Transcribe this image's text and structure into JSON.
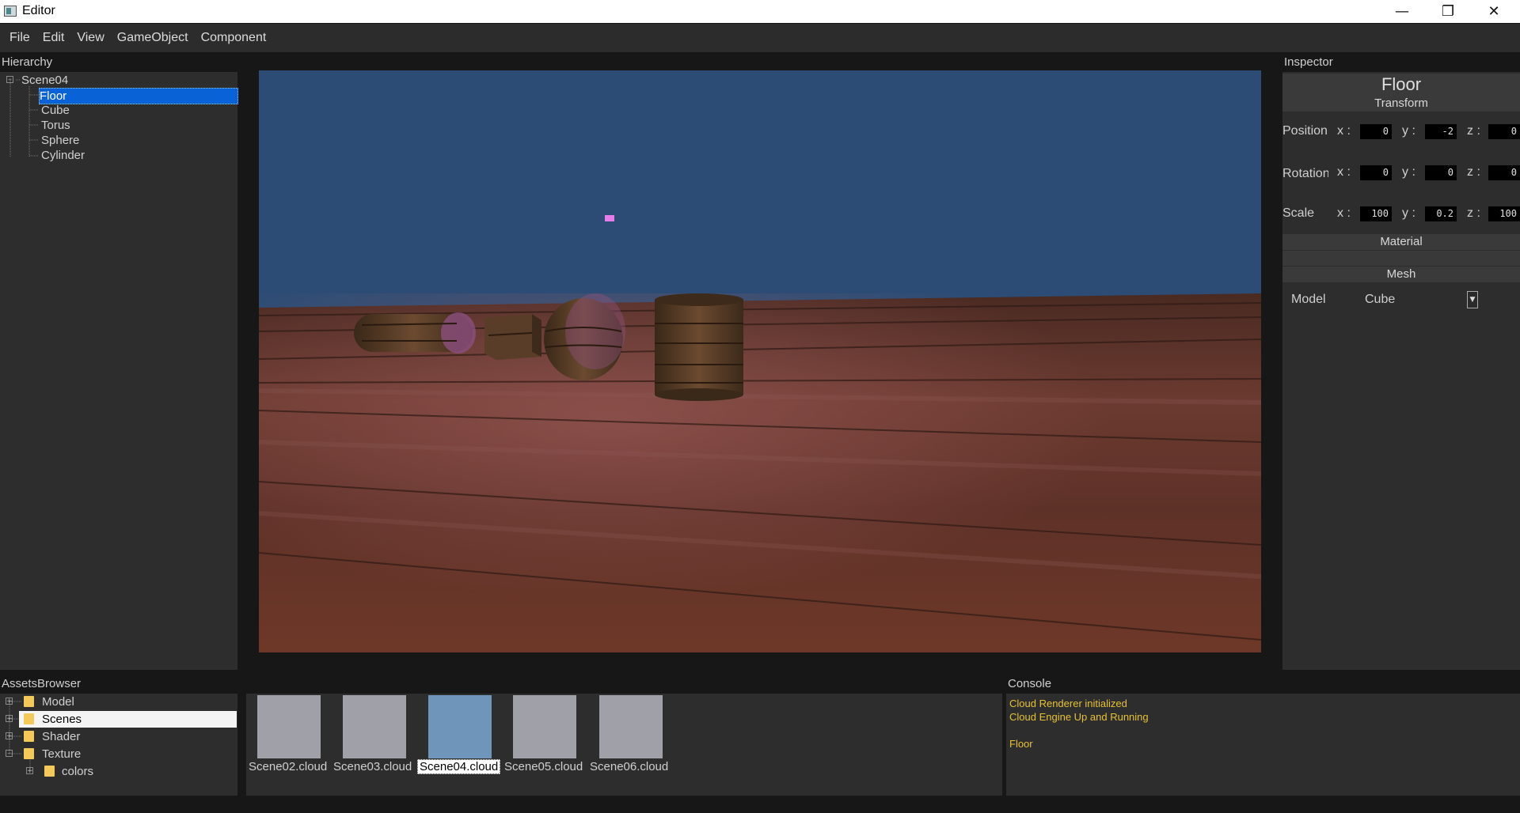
{
  "window": {
    "title": "Editor",
    "controls": [
      "minimize",
      "restore",
      "close"
    ]
  },
  "menubar": {
    "items": [
      "File",
      "Edit",
      "View",
      "GameObject",
      "Component"
    ]
  },
  "hierarchy": {
    "label": "Hierarchy",
    "root": "Scene04",
    "items": [
      {
        "label": "Floor",
        "selected": true
      },
      {
        "label": "Cube"
      },
      {
        "label": "Torus"
      },
      {
        "label": "Sphere"
      },
      {
        "label": "Cylinder"
      }
    ]
  },
  "inspector": {
    "label": "Inspector",
    "object_name": "Floor",
    "transform": {
      "header": "Transform",
      "rows": [
        {
          "label": "Position",
          "x": "0",
          "y": "-2",
          "z": "0"
        },
        {
          "label": "Rotation",
          "x": "0",
          "y": "0",
          "z": "0"
        },
        {
          "label": "Scale",
          "x": "100",
          "y": "0.2",
          "z": "100"
        }
      ],
      "axis_labels": [
        "x :",
        "y :",
        "z :"
      ]
    },
    "material": {
      "header": "Material"
    },
    "mesh": {
      "header": "Mesh",
      "model_label": "Model",
      "model_value": "Cube"
    }
  },
  "assets": {
    "label": "AssetsBrowser",
    "folders": [
      {
        "label": "Model"
      },
      {
        "label": "Scenes",
        "selected": true
      },
      {
        "label": "Shader"
      },
      {
        "label": "Texture"
      },
      {
        "label": "colors"
      }
    ],
    "files": [
      {
        "label": "Scene02.cloud"
      },
      {
        "label": "Scene03.cloud"
      },
      {
        "label": "Scene04.cloud",
        "selected": true
      },
      {
        "label": "Scene05.cloud"
      },
      {
        "label": "Scene06.cloud"
      }
    ]
  },
  "console": {
    "label": "Console",
    "lines": [
      "Cloud Renderer initialized",
      "Cloud Engine Up and Running",
      "",
      "Floor"
    ]
  },
  "colors": {
    "sky": "#2c4c75",
    "selection": "#0a63d6",
    "console_text": "#e7c230"
  }
}
